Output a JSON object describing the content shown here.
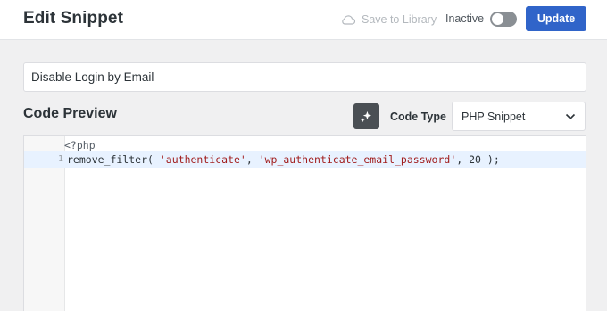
{
  "header": {
    "title": "Edit Snippet",
    "save_to_library": "Save to Library",
    "status_label": "Inactive",
    "status_active": false,
    "update_label": "Update"
  },
  "snippet": {
    "title_value": "Disable Login by Email"
  },
  "code_preview": {
    "section_title": "Code Preview",
    "code_type_label": "Code Type",
    "code_type_value": "PHP Snippet",
    "lines": [
      {
        "number": "",
        "text": "<?php"
      },
      {
        "number": "1",
        "fn": "remove_filter(",
        "arg1": "'authenticate'",
        "sep1": ",",
        "arg2": "'wp_authenticate_email_password'",
        "sep2": ",",
        "arg3": "20",
        "end": ");"
      }
    ]
  },
  "colors": {
    "accent": "#3064c9",
    "string": "#a11d1d",
    "active_line": "#e8f2ff"
  },
  "icons": [
    "cloud-icon",
    "toggle-switch",
    "ai-sparkle-icon",
    "chevron-down-icon"
  ]
}
